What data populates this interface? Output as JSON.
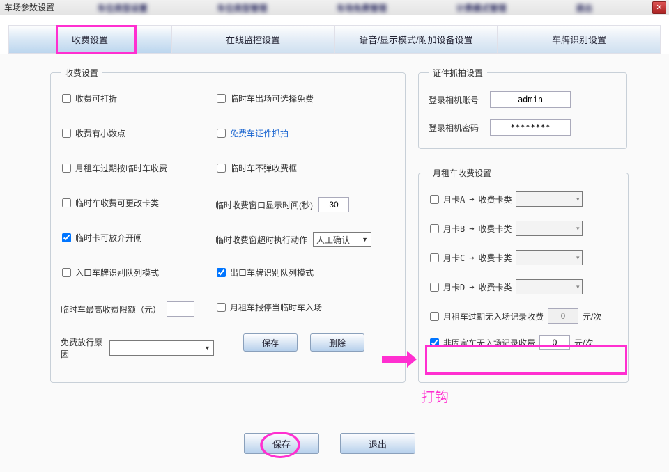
{
  "window": {
    "title": "车场参数设置"
  },
  "tabs": [
    "收费设置",
    "在线监控设置",
    "语音/显示模式/附加设备设置",
    "车牌识别设置"
  ],
  "feeGroup": {
    "legend": "收费设置",
    "left": {
      "discount": "收费可打折",
      "decimal": "收费有小数点",
      "monthExpire": "月租车过期按临时车收费",
      "tempChangeCat": "临时车收费可更改卡类",
      "tempAbandon": "临时卡可放弃开闸",
      "entryQueue": "入口车牌识别队列模式",
      "tempMaxLabel": "临时车最高收费限额（元）",
      "tempMaxValue": "",
      "freeReasonLabel": "免费放行原因",
      "freeReasonValue": ""
    },
    "right": {
      "tempFreeExit": "临时车出场可选择免费",
      "freeDocCapture": "免费车证件抓拍",
      "tempNoDialog": "临时车不弹收费框",
      "tempWindowLabel": "临时收费窗口显示时间(秒)",
      "tempWindowValue": "30",
      "tempTimeoutLabel": "临时收费窗超时执行动作",
      "tempTimeoutValue": "人工确认",
      "exitQueue": "出口车牌识别队列模式",
      "monthParkReport": "月租车报停当临时车入场",
      "saveBtn": "保存",
      "deleteBtn": "删除"
    }
  },
  "camGroup": {
    "legend": "证件抓拍设置",
    "userLabel": "登录相机账号",
    "userValue": "admin",
    "pwdLabel": "登录相机密码",
    "pwdValue": "********"
  },
  "monthGroup": {
    "legend": "月租车收费设置",
    "rows": [
      {
        "card": "月卡A",
        "arrow": "→",
        "label": "收费卡类"
      },
      {
        "card": "月卡B",
        "arrow": "→",
        "label": "收费卡类"
      },
      {
        "card": "月卡C",
        "arrow": "→",
        "label": "收费卡类"
      },
      {
        "card": "月卡D",
        "arrow": "→",
        "label": "收费卡类"
      }
    ],
    "expiredNoEntryLabel": "月租车过期无入场记录收费",
    "expiredNoEntryValue": "0",
    "unit": "元/次",
    "nonFixedLabel": "非固定车无入场记录收费",
    "nonFixedValue": "0"
  },
  "annotation": {
    "check": "打钩"
  },
  "footer": {
    "save": "保存",
    "exit": "退出"
  }
}
